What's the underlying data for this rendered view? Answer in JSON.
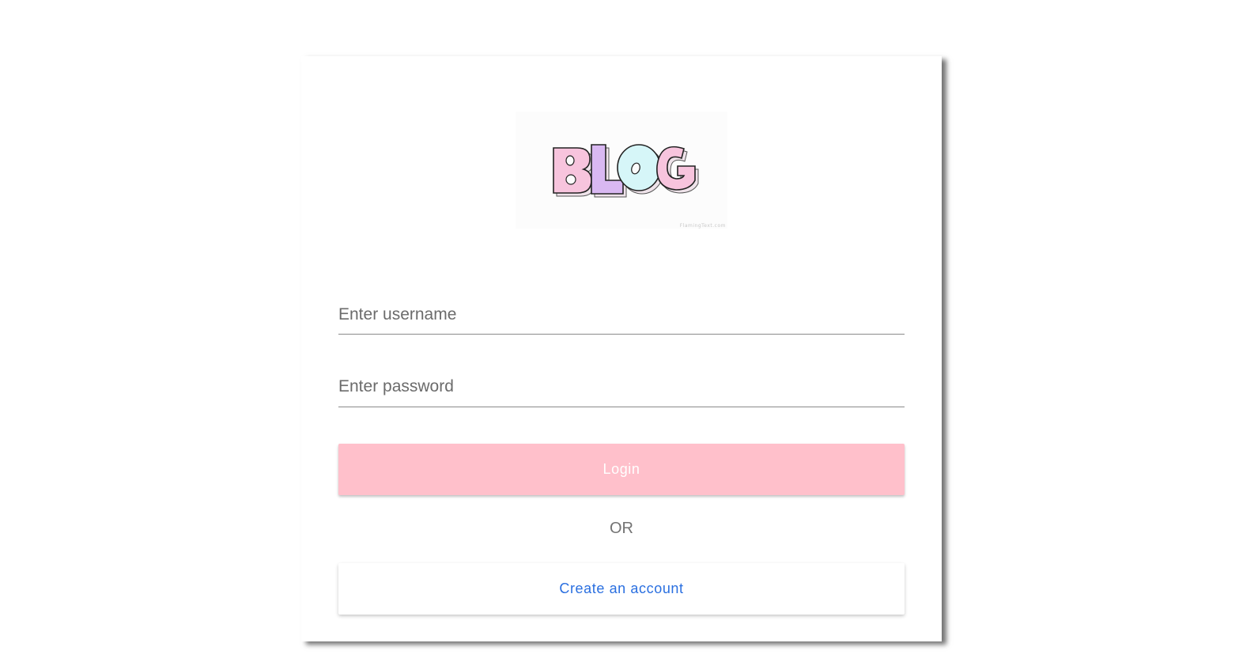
{
  "logo": {
    "alt": "BLOG",
    "letters": [
      "B",
      "L",
      "O",
      "G"
    ],
    "letter_colors": [
      "#f7c4dd",
      "#d9b8f2",
      "#d6f6f8",
      "#f7c4dd"
    ],
    "credit": "FlamingText.com"
  },
  "form": {
    "username_placeholder": "Enter username",
    "password_placeholder": "Enter password",
    "login_label": "Login",
    "or_label": "OR",
    "signup_label": "Create an account"
  },
  "colors": {
    "login_bg": "#ffc0cb",
    "signup_text": "#2a6fe0"
  }
}
